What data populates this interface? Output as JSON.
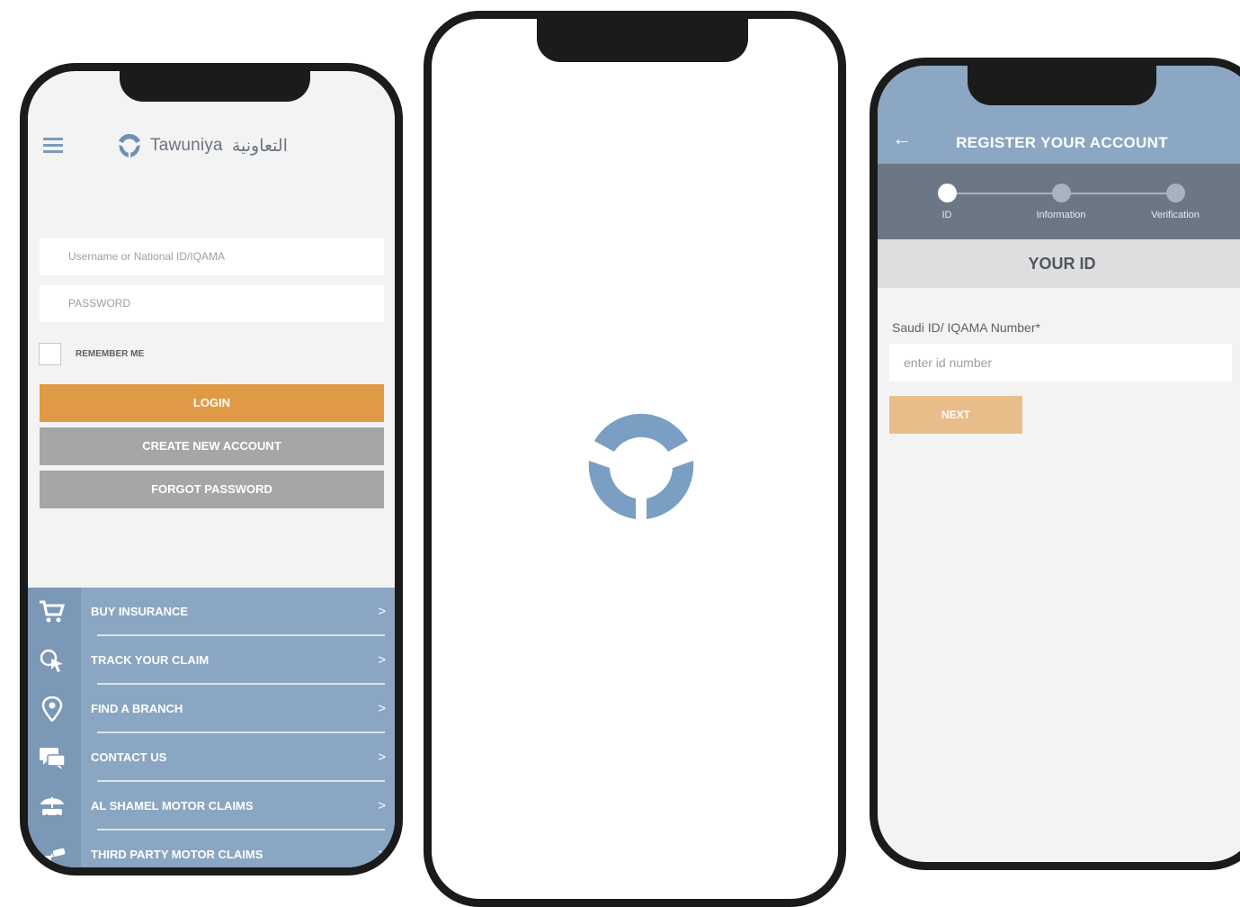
{
  "login_screen": {
    "brand": {
      "name_en": "Tawuniya",
      "name_ar": "التعاونية"
    },
    "username_placeholder": "Username or National ID/IQAMA",
    "password_placeholder": "PASSWORD",
    "remember_label": "REMEMBER ME",
    "login_label": "LOGIN",
    "create_account_label": "CREATE NEW ACCOUNT",
    "forgot_password_label": "FORGOT PASSWORD",
    "menu": [
      {
        "label": "BUY INSURANCE",
        "icon": "cart-icon"
      },
      {
        "label": "TRACK YOUR CLAIM",
        "icon": "track-search-icon"
      },
      {
        "label": "FIND A BRANCH",
        "icon": "location-pin-icon"
      },
      {
        "label": "CONTACT US",
        "icon": "chat-bubbles-icon"
      },
      {
        "label": "AL SHAMEL MOTOR CLAIMS",
        "icon": "umbrella-car-icon"
      },
      {
        "label": "THIRD PARTY MOTOR CLAIMS",
        "icon": "car-collision-icon"
      }
    ],
    "chevron": ">"
  },
  "splash_screen": {
    "icon": "tawuniya-logo-spinner-icon"
  },
  "register_screen": {
    "back_icon": "←",
    "title": "REGISTER YOUR ACCOUNT",
    "steps": [
      {
        "label": "ID",
        "active": true
      },
      {
        "label": "Information",
        "active": false
      },
      {
        "label": "Verification",
        "active": false
      }
    ],
    "section_title": "YOUR ID",
    "id_label": "Saudi ID/ IQAMA Number*",
    "id_placeholder": "enter id number",
    "next_label": "NEXT"
  },
  "colors": {
    "brand_blue": "#7a9bb9",
    "accent_orange": "#e09a45",
    "button_gray": "#a6a6a6",
    "stepper_gray": "#6b7785",
    "frame": "#1b1b1b"
  }
}
